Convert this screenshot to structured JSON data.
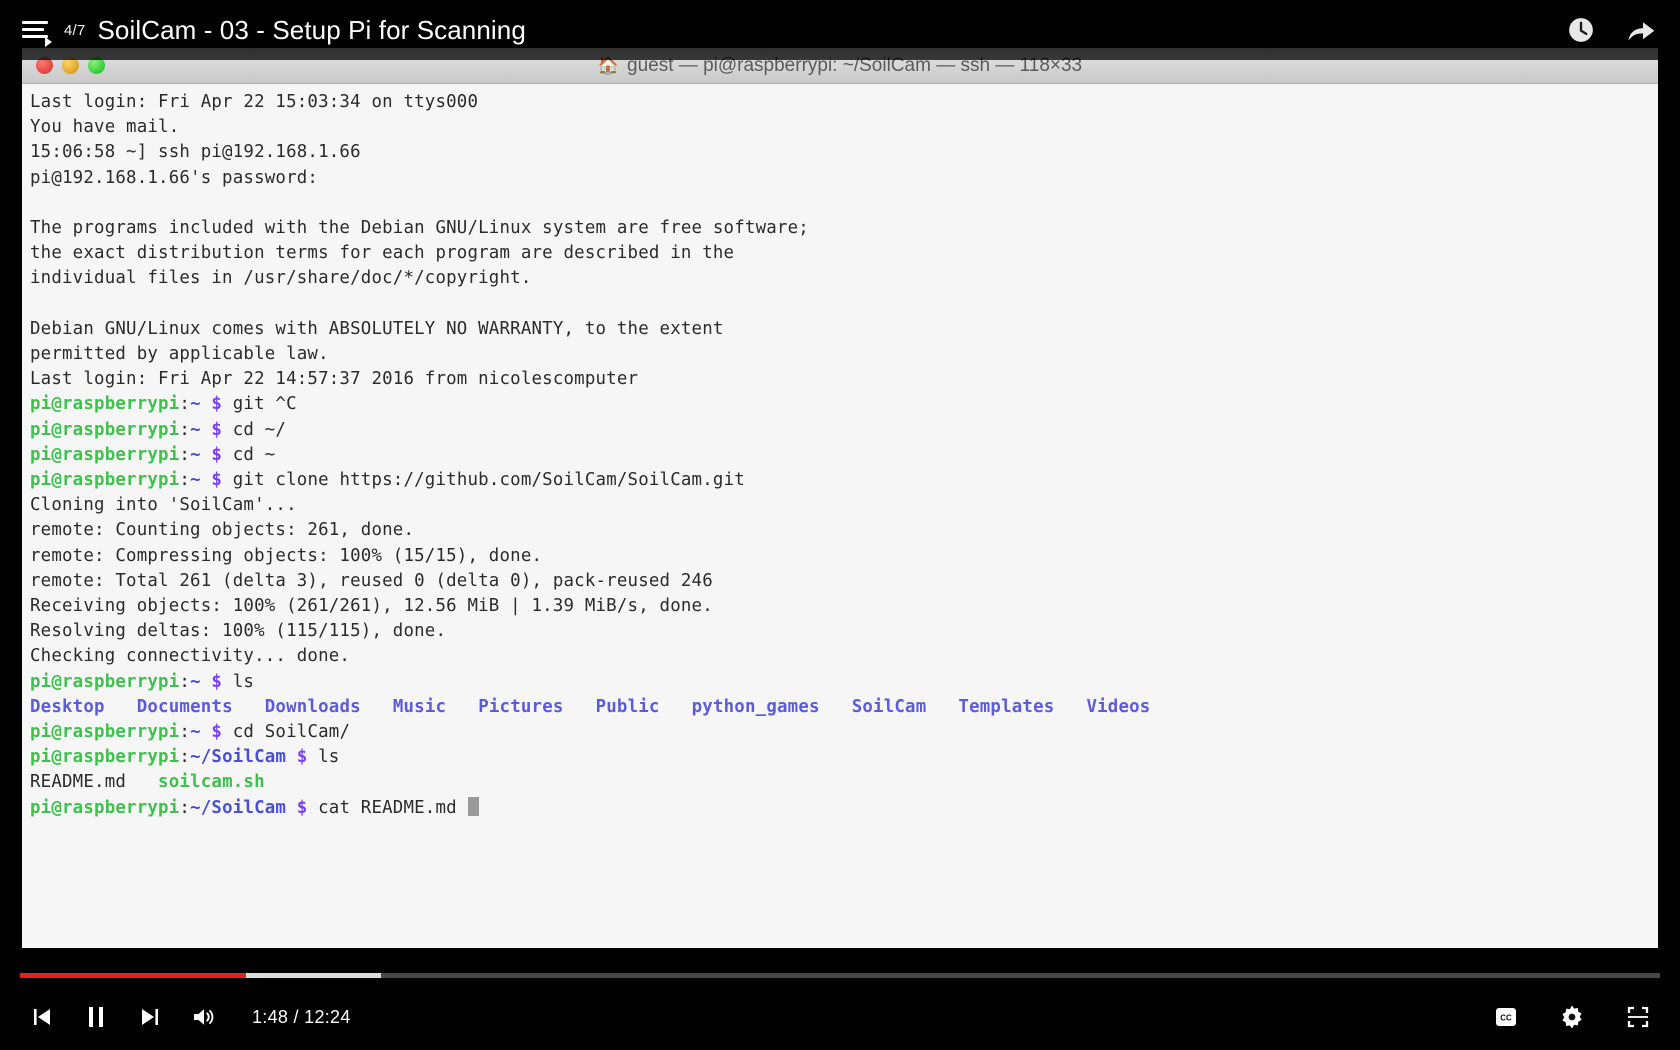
{
  "topbar": {
    "menu_icon": "playlist-menu-icon",
    "counter": "4/7",
    "title": "SoilCam - 03 - Setup Pi for Scanning",
    "watch_later_icon": "clock-icon",
    "share_icon": "share-icon"
  },
  "terminal": {
    "title": "guest — pi@raspberrypi: ~/SoilCam — ssh — 118×33",
    "folder_icon": "home-folder-icon",
    "close_button": "close-window-button",
    "minimize_button": "minimize-window-button",
    "zoom_button": "zoom-window-button",
    "lines": [
      {
        "segments": [
          {
            "t": "Last login: Fri Apr 22 15:03:34 on ttys000",
            "c": ""
          }
        ]
      },
      {
        "segments": [
          {
            "t": "You have mail.",
            "c": ""
          }
        ]
      },
      {
        "segments": [
          {
            "t": "15:06:58 ~] ssh pi@192.168.1.66",
            "c": ""
          }
        ]
      },
      {
        "segments": [
          {
            "t": "pi@192.168.1.66's password:",
            "c": ""
          }
        ]
      },
      {
        "segments": [
          {
            "t": "",
            "c": ""
          }
        ]
      },
      {
        "segments": [
          {
            "t": "The programs included with the Debian GNU/Linux system are free software;",
            "c": ""
          }
        ]
      },
      {
        "segments": [
          {
            "t": "the exact distribution terms for each program are described in the",
            "c": ""
          }
        ]
      },
      {
        "segments": [
          {
            "t": "individual files in /usr/share/doc/*/copyright.",
            "c": ""
          }
        ]
      },
      {
        "segments": [
          {
            "t": "",
            "c": ""
          }
        ]
      },
      {
        "segments": [
          {
            "t": "Debian GNU/Linux comes with ABSOLUTELY NO WARRANTY, to the extent",
            "c": ""
          }
        ]
      },
      {
        "segments": [
          {
            "t": "permitted by applicable law.",
            "c": ""
          }
        ]
      },
      {
        "segments": [
          {
            "t": "Last login: Fri Apr 22 14:57:37 2016 from nicolescomputer",
            "c": ""
          }
        ]
      },
      {
        "segments": [
          {
            "t": "pi@raspberrypi",
            "c": "c-green"
          },
          {
            "t": ":",
            "c": ""
          },
          {
            "t": "~",
            "c": "c-blue"
          },
          {
            "t": " ",
            "c": ""
          },
          {
            "t": "$",
            "c": "c-purple"
          },
          {
            "t": " git ^C",
            "c": ""
          }
        ]
      },
      {
        "segments": [
          {
            "t": "pi@raspberrypi",
            "c": "c-green"
          },
          {
            "t": ":",
            "c": ""
          },
          {
            "t": "~",
            "c": "c-blue"
          },
          {
            "t": " ",
            "c": ""
          },
          {
            "t": "$",
            "c": "c-purple"
          },
          {
            "t": " cd ~/",
            "c": ""
          }
        ]
      },
      {
        "segments": [
          {
            "t": "pi@raspberrypi",
            "c": "c-green"
          },
          {
            "t": ":",
            "c": ""
          },
          {
            "t": "~",
            "c": "c-blue"
          },
          {
            "t": " ",
            "c": ""
          },
          {
            "t": "$",
            "c": "c-purple"
          },
          {
            "t": " cd ~",
            "c": ""
          }
        ]
      },
      {
        "segments": [
          {
            "t": "pi@raspberrypi",
            "c": "c-green"
          },
          {
            "t": ":",
            "c": ""
          },
          {
            "t": "~",
            "c": "c-blue"
          },
          {
            "t": " ",
            "c": ""
          },
          {
            "t": "$",
            "c": "c-purple"
          },
          {
            "t": " git clone https://github.com/SoilCam/SoilCam.git",
            "c": ""
          }
        ]
      },
      {
        "segments": [
          {
            "t": "Cloning into 'SoilCam'...",
            "c": ""
          }
        ]
      },
      {
        "segments": [
          {
            "t": "remote: Counting objects: 261, done.",
            "c": ""
          }
        ]
      },
      {
        "segments": [
          {
            "t": "remote: Compressing objects: 100% (15/15), done.",
            "c": ""
          }
        ]
      },
      {
        "segments": [
          {
            "t": "remote: Total 261 (delta 3), reused 0 (delta 0), pack-reused 246",
            "c": ""
          }
        ]
      },
      {
        "segments": [
          {
            "t": "Receiving objects: 100% (261/261), 12.56 MiB | 1.39 MiB/s, done.",
            "c": ""
          }
        ]
      },
      {
        "segments": [
          {
            "t": "Resolving deltas: 100% (115/115), done.",
            "c": ""
          }
        ]
      },
      {
        "segments": [
          {
            "t": "Checking connectivity... done.",
            "c": ""
          }
        ]
      },
      {
        "segments": [
          {
            "t": "pi@raspberrypi",
            "c": "c-green"
          },
          {
            "t": ":",
            "c": ""
          },
          {
            "t": "~",
            "c": "c-blue"
          },
          {
            "t": " ",
            "c": ""
          },
          {
            "t": "$",
            "c": "c-purple"
          },
          {
            "t": " ls",
            "c": ""
          }
        ]
      },
      {
        "segments": [
          {
            "t": "Desktop",
            "c": "c-dir"
          },
          {
            "t": "   ",
            "c": ""
          },
          {
            "t": "Documents",
            "c": "c-dir"
          },
          {
            "t": "   ",
            "c": ""
          },
          {
            "t": "Downloads",
            "c": "c-dir"
          },
          {
            "t": "   ",
            "c": ""
          },
          {
            "t": "Music",
            "c": "c-dir"
          },
          {
            "t": "   ",
            "c": ""
          },
          {
            "t": "Pictures",
            "c": "c-dir"
          },
          {
            "t": "   ",
            "c": ""
          },
          {
            "t": "Public",
            "c": "c-dir"
          },
          {
            "t": "   ",
            "c": ""
          },
          {
            "t": "python_games",
            "c": "c-dir"
          },
          {
            "t": "   ",
            "c": ""
          },
          {
            "t": "SoilCam",
            "c": "c-dir"
          },
          {
            "t": "   ",
            "c": ""
          },
          {
            "t": "Templates",
            "c": "c-dir"
          },
          {
            "t": "   ",
            "c": ""
          },
          {
            "t": "Videos",
            "c": "c-dir"
          }
        ]
      },
      {
        "segments": [
          {
            "t": "pi@raspberrypi",
            "c": "c-green"
          },
          {
            "t": ":",
            "c": ""
          },
          {
            "t": "~",
            "c": "c-blue"
          },
          {
            "t": " ",
            "c": ""
          },
          {
            "t": "$",
            "c": "c-purple"
          },
          {
            "t": " cd SoilCam/",
            "c": ""
          }
        ]
      },
      {
        "segments": [
          {
            "t": "pi@raspberrypi",
            "c": "c-green"
          },
          {
            "t": ":",
            "c": ""
          },
          {
            "t": "~/SoilCam",
            "c": "c-blue"
          },
          {
            "t": " ",
            "c": ""
          },
          {
            "t": "$",
            "c": "c-purple"
          },
          {
            "t": " ls",
            "c": ""
          }
        ]
      },
      {
        "segments": [
          {
            "t": "README.md",
            "c": ""
          },
          {
            "t": "   ",
            "c": ""
          },
          {
            "t": "soilcam.sh",
            "c": "c-exec"
          }
        ]
      },
      {
        "segments": [
          {
            "t": "pi@raspberrypi",
            "c": "c-green"
          },
          {
            "t": ":",
            "c": ""
          },
          {
            "t": "~/SoilCam",
            "c": "c-blue"
          },
          {
            "t": " ",
            "c": ""
          },
          {
            "t": "$",
            "c": "c-purple"
          },
          {
            "t": " cat README.md ",
            "c": ""
          },
          {
            "t": "",
            "c": "cursor"
          }
        ]
      }
    ]
  },
  "progress": {
    "played_percent": 13.8,
    "buffered_percent": 22.0,
    "played_color": "#e62117",
    "buffered_color": "#dcdcdc"
  },
  "controls": {
    "prev_icon": "previous-track-icon",
    "pause_icon": "pause-icon",
    "next_icon": "next-track-icon",
    "volume_icon": "volume-icon",
    "timecode": "1:48 / 12:24",
    "current_time": "1:48",
    "duration": "12:24",
    "captions_icon": "closed-captions-icon",
    "settings_icon": "gear-icon",
    "fullscreen_icon": "fullscreen-icon"
  }
}
